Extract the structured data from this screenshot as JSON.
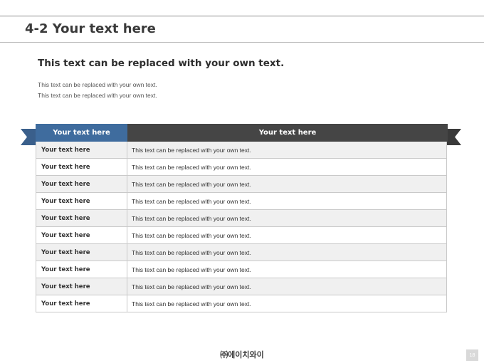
{
  "slide": {
    "title": "4-2 Your text here",
    "subtitle": "This text can be replaced with your own text.",
    "body_lines": [
      "This text can be replaced with your own text.",
      "This text can be replaced with your own text."
    ]
  },
  "table": {
    "headers": [
      "Your text here",
      "Your text here"
    ],
    "rows": [
      [
        "Your text here",
        "This text can be replaced with your own text."
      ],
      [
        "Your text here",
        "This text can be replaced with your own text."
      ],
      [
        "Your text here",
        "This text can be replaced with your own text."
      ],
      [
        "Your text here",
        "This text can be replaced with your own text."
      ],
      [
        "Your text here",
        "This text can be replaced with your own text."
      ],
      [
        "Your text here",
        "This text can be replaced with your own text."
      ],
      [
        "Your text here",
        "This text can be replaced with your own text."
      ],
      [
        "Your text here",
        "This text can be replaced with your own text."
      ],
      [
        "Your text here",
        "This text can be replaced with your own text."
      ],
      [
        "Your text here",
        "This text can be replaced with your own text."
      ]
    ]
  },
  "footer": {
    "logo": "㈜에이치와이",
    "page_number": "18"
  },
  "colors": {
    "header_blue": "#3f6c9e",
    "header_dark": "#454545",
    "ribbon_tail_blue": "#3a5f8b",
    "ribbon_tail_dark": "#3a3a3a"
  }
}
